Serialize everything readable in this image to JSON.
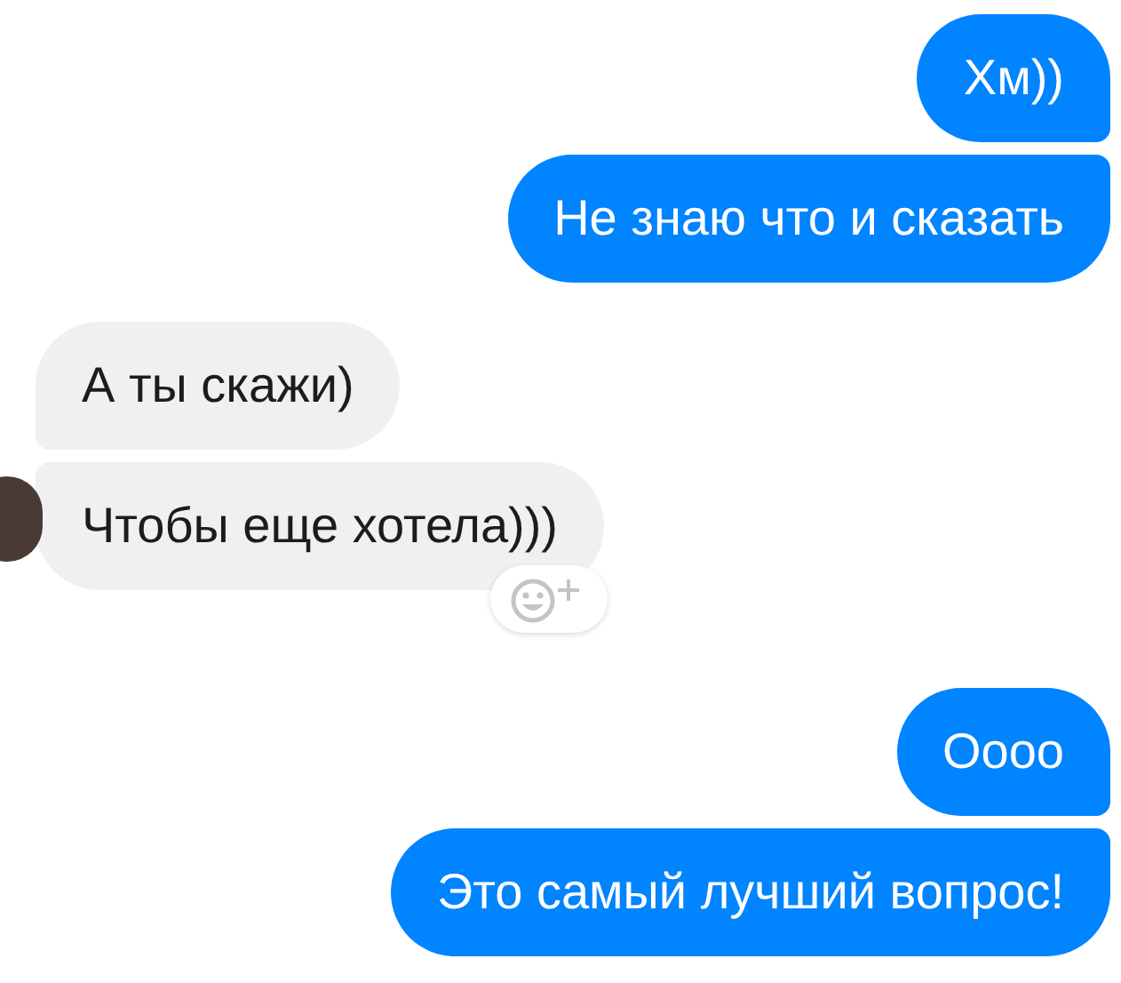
{
  "messages": [
    {
      "kind": "out",
      "text": "Хм))"
    },
    {
      "kind": "out",
      "text": "Не знаю что и сказать"
    },
    {
      "kind": "in",
      "text": "А ты скажи)"
    },
    {
      "kind": "in",
      "text": "Чтобы еще хотела)))",
      "reaction_button": true,
      "avatar": true
    },
    {
      "kind": "out",
      "text": "Оооо",
      "gap": true
    },
    {
      "kind": "out",
      "text": "Это самый лучший вопрос!"
    }
  ]
}
